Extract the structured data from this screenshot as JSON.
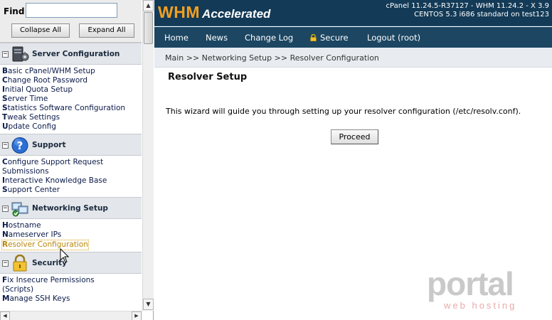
{
  "left": {
    "find_label": "Find",
    "find_value": "",
    "collapse_all": "Collapse All",
    "expand_all": "Expand All",
    "sections": [
      {
        "title": "Server Configuration",
        "icon": "server-icon",
        "links": [
          {
            "first": "B",
            "rest": "asic cPanel/WHM Setup"
          },
          {
            "first": "C",
            "rest": "hange Root Password"
          },
          {
            "first": "I",
            "rest": "nitial Quota Setup"
          },
          {
            "first": "S",
            "rest": "erver Time"
          },
          {
            "first": "S",
            "rest": "tatistics Software Configuration"
          },
          {
            "first": "T",
            "rest": "weak Settings"
          },
          {
            "first": "U",
            "rest": "pdate Config"
          }
        ]
      },
      {
        "title": "Support",
        "icon": "help-icon",
        "links": [
          {
            "first": "C",
            "rest": "onfigure Support Request"
          },
          {
            "first": "",
            "rest": "Submissions"
          },
          {
            "first": "I",
            "rest": "nteractive Knowledge Base"
          },
          {
            "first": "S",
            "rest": "upport Center"
          }
        ]
      },
      {
        "title": "Networking Setup",
        "icon": "network-icon",
        "links": [
          {
            "first": "H",
            "rest": "ostname"
          },
          {
            "first": "N",
            "rest": "ameserver IPs"
          },
          {
            "first": "R",
            "rest": "esolver Configuration"
          }
        ]
      },
      {
        "title": "Security",
        "icon": "lock-icon",
        "links": [
          {
            "first": "F",
            "rest": "ix Insecure Permissions"
          },
          {
            "first": "",
            "rest": "(Scripts)"
          },
          {
            "first": "M",
            "rest": "anage SSH Keys"
          }
        ]
      }
    ]
  },
  "header": {
    "logo_main": "WHM",
    "logo_sub": "Accelerated",
    "version_line1": "cPanel 11.24.5-R37127 - WHM 11.24.2 - X 3.9",
    "version_line2": "CENTOS 5.3 i686 standard on test123"
  },
  "nav": {
    "home": "Home",
    "news": "News",
    "changelog": "Change Log",
    "secure": "Secure",
    "logout": "Logout (root)"
  },
  "breadcrumb": "Main >> Networking Setup >> Resolver Configuration",
  "main": {
    "title": "Resolver Setup",
    "description": "This wizard will guide you through setting up your resolver configuration (/etc/resolv.conf).",
    "proceed": "Proceed"
  },
  "watermark": {
    "brand": "portal",
    "sub": "web hosting"
  },
  "colors": {
    "banner": "#133a56",
    "navbar": "#1c4662",
    "logo_orange": "#f0a020",
    "active_link": "#b8860b"
  }
}
